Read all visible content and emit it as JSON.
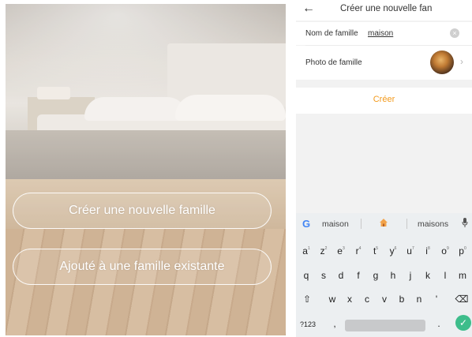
{
  "left": {
    "create_button": "Créer une nouvelle famille",
    "join_button": "Ajouté à une famille existante"
  },
  "right": {
    "back_icon": "←",
    "title": "Créer une nouvelle fan",
    "name_label": "Nom de famille",
    "name_value": "maison",
    "clear_icon": "×",
    "photo_label": "Photo de famille",
    "chevron_icon": "›",
    "create_label": "Créer",
    "accent_color": "#f39a1c"
  },
  "keyboard": {
    "google": "G",
    "suggestion_left": "maison",
    "suggestion_right": "maisons",
    "row1": [
      "a",
      "z",
      "e",
      "r",
      "t",
      "y",
      "u",
      "i",
      "o",
      "p"
    ],
    "row1_hints": [
      "1",
      "2",
      "3",
      "4",
      "5",
      "6",
      "7",
      "8",
      "9",
      "0"
    ],
    "row2": [
      "q",
      "s",
      "d",
      "f",
      "g",
      "h",
      "j",
      "k",
      "l",
      "m"
    ],
    "row3": [
      "w",
      "x",
      "c",
      "v",
      "b",
      "n",
      "'"
    ],
    "shift_icon": "⇧",
    "backspace_icon": "⌫",
    "numbers_key": "?123",
    "comma_key": ",",
    "period_key": ".",
    "enter_icon": "✓"
  }
}
